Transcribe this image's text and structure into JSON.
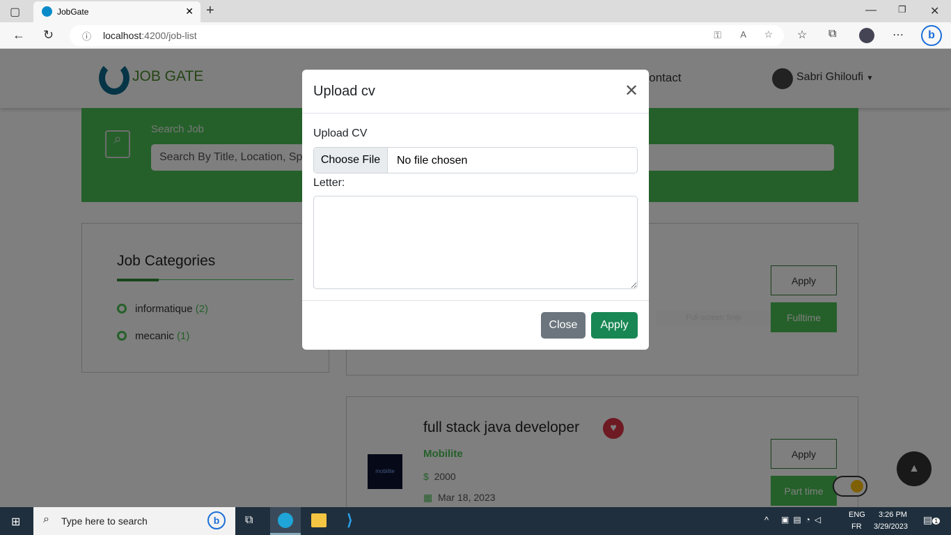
{
  "browser": {
    "tab_title": "JobGate",
    "url_host": "localhost",
    "url_path": ":4200/job-list"
  },
  "navbar": {
    "logo_text": "JOB GATE",
    "contact": "Contact",
    "user_name": "Sabri Ghiloufi"
  },
  "search": {
    "label": "Search Job",
    "placeholder": "Search By Title, Location, Speciality..."
  },
  "categories": {
    "title": "Job Categories",
    "items": [
      {
        "name": "informatique",
        "count": "(2)"
      },
      {
        "name": "mecanic",
        "count": "(1)"
      }
    ]
  },
  "jobs": [
    {
      "apply": "Apply",
      "type": "Fulltime"
    },
    {
      "title": "full stack java developer",
      "company": "Mobilite",
      "logo_text": "mobilite",
      "salary": "2000",
      "date": "Mar 18, 2023",
      "apply": "Apply",
      "type": "Part time"
    }
  ],
  "snip_tooltip": "Full-screen Snip",
  "modal": {
    "title": "Upload cv",
    "upload_label": "Upload CV",
    "choose_file": "Choose File",
    "no_file": "No file chosen",
    "letter_label": "Letter:",
    "letter_value": "",
    "close": "Close",
    "apply": "Apply"
  },
  "taskbar": {
    "search_placeholder": "Type here to search",
    "lang1": "ENG",
    "lang2": "FR",
    "time": "3:26 PM",
    "date": "3/29/2023",
    "notif_count": "1"
  }
}
